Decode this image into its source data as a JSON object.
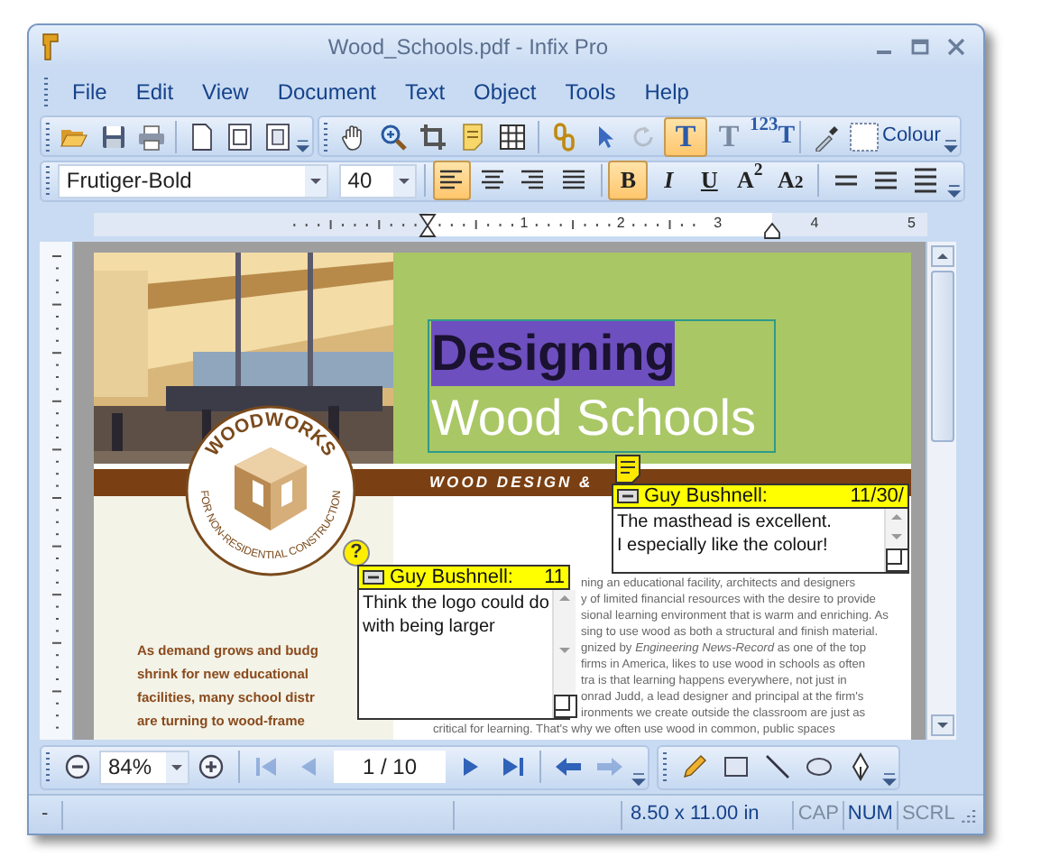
{
  "window": {
    "title": "Wood_Schools.pdf - Infix Pro"
  },
  "menu": [
    "File",
    "Edit",
    "View",
    "Document",
    "Text",
    "Object",
    "Tools",
    "Help"
  ],
  "standard_toolbar": {
    "groups": [
      [
        {
          "kind": "open",
          "selected": false,
          "disabled": false
        },
        {
          "kind": "save",
          "selected": false,
          "disabled": false
        },
        {
          "kind": "print",
          "selected": false,
          "disabled": false
        }
      ],
      [
        {
          "kind": "page",
          "selected": false,
          "disabled": false
        },
        {
          "kind": "page_frame",
          "selected": false,
          "disabled": false
        },
        {
          "kind": "page_corner",
          "selected": false,
          "disabled": false
        }
      ]
    ]
  },
  "tools_toolbar": {
    "groups": [
      [
        {
          "kind": "hand",
          "selected": false,
          "disabled": false
        },
        {
          "kind": "zoom",
          "selected": false,
          "disabled": false
        },
        {
          "kind": "crop",
          "selected": false,
          "disabled": false
        },
        {
          "kind": "note",
          "selected": false,
          "disabled": false
        },
        {
          "kind": "grid",
          "selected": false,
          "disabled": false
        }
      ],
      [
        {
          "kind": "link",
          "selected": false,
          "disabled": false
        },
        {
          "kind": "pointer",
          "selected": false,
          "disabled": false
        },
        {
          "kind": "rotate",
          "selected": false,
          "disabled": true
        },
        {
          "kind": "text_tool",
          "label": "T",
          "selected": true,
          "disabled": false
        },
        {
          "kind": "text_flow",
          "label": "T",
          "selected": false,
          "disabled": false
        },
        {
          "kind": "text_numbers",
          "label": "$^{123}$T",
          "selected": false,
          "disabled": false
        }
      ],
      [
        {
          "kind": "eyedropper",
          "selected": false,
          "disabled": false
        },
        {
          "kind": "colour",
          "label": "Colour",
          "selected": false,
          "disabled": false
        }
      ]
    ]
  },
  "format_toolbar": {
    "font": "Frutiger-Bold",
    "size": "40",
    "groups": [
      [
        {
          "kind": "align_left",
          "selected": true
        },
        {
          "kind": "align_center",
          "selected": false
        },
        {
          "kind": "align_right",
          "selected": false
        },
        {
          "kind": "justify",
          "selected": false
        }
      ],
      [
        {
          "kind": "style",
          "label": "B",
          "selected": true
        },
        {
          "kind": "style",
          "label": "I",
          "selected": false
        },
        {
          "kind": "style",
          "label": "U",
          "selected": false
        },
        {
          "kind": "style",
          "label": "A$^{2}$",
          "selected": false
        },
        {
          "kind": "style",
          "label": "A$_{2}$",
          "selected": false
        }
      ],
      [
        {
          "kind": "spacing_single",
          "selected": false
        },
        {
          "kind": "spacing_medium",
          "selected": false
        },
        {
          "kind": "spacing_double",
          "selected": false
        }
      ]
    ]
  },
  "ruler": [
    "1",
    "2",
    "3",
    "4",
    "5"
  ],
  "document": {
    "headline": [
      {
        "text": "Designing",
        "selected": true
      },
      {
        "text": "Wood Schools",
        "selected": false
      }
    ],
    "band": "WOOD DESIGN &",
    "logo": {
      "top": "WOODWORKS",
      "bottom": "FOR NON-RESIDENTIAL CONSTRUCTION"
    },
    "intro_lines": [
      "As demand grows and budg",
      "shrink for new educational",
      "facilities, many school distr",
      "are turning to wood-frame"
    ],
    "body_lines": [
      {
        "text": "ning an educational facility, architects and designers",
        "kind": "partial"
      },
      {
        "text": "y of limited financial resources with the desire to provide",
        "kind": "partial"
      },
      {
        "text": "sional learning environment that is warm and enriching. As",
        "kind": "partial"
      },
      {
        "text": "sing to use wood as both a structural and finish material.",
        "kind": "partial"
      },
      {
        "text": "gnized by *Engineering News-Record* as one of the top",
        "kind": "partial"
      },
      {
        "text": "firms in America, likes to use wood in schools as often",
        "kind": "partial"
      },
      {
        "text": "tra is that learning happens everywhere, not just in",
        "kind": "partial"
      },
      {
        "text": "onrad Judd, a lead designer and principal at the firm's",
        "kind": "partial"
      },
      {
        "text": "ironments we create outside the classroom are just as",
        "kind": "partial"
      },
      {
        "text": "critical for learning. That's why we often use wood in common, public spaces",
        "kind": "full"
      }
    ],
    "notes": [
      {
        "marker": {
          "kind": "comment"
        },
        "author": "Guy Bushnell:",
        "date": "11/30/",
        "lines": [
          "The masthead is excellent.",
          "I especially like the colour!"
        ]
      },
      {
        "marker": {
          "kind": "question",
          "label": "?"
        },
        "author": "Guy Bushnell:",
        "date": "11",
        "lines": [
          "Think the logo could do",
          "with being larger"
        ]
      }
    ]
  },
  "navigation_toolbar": {
    "zoom": "84%",
    "page": "1 / 10",
    "groups": [
      [
        {
          "kind": "zoom_out",
          "disabled": false
        }
      ],
      [
        {
          "kind": "zoom_in",
          "disabled": false
        }
      ],
      [
        {
          "kind": "first",
          "disabled": true
        },
        {
          "kind": "prev",
          "disabled": true
        }
      ],
      [
        {
          "kind": "next",
          "disabled": false
        },
        {
          "kind": "last",
          "disabled": false
        }
      ],
      [
        {
          "kind": "back",
          "disabled": false
        },
        {
          "kind": "forward",
          "disabled": true
        }
      ]
    ]
  },
  "drawing_toolbar": [
    {
      "kind": "pencil"
    },
    {
      "kind": "rectangle"
    },
    {
      "kind": "line"
    },
    {
      "kind": "ellipse"
    },
    {
      "kind": "pen"
    }
  ],
  "status_bar": {
    "left": "-",
    "page_size": "8.50 x 11.00 in",
    "indicators": [
      {
        "text": "CAP",
        "on": false
      },
      {
        "text": "NUM",
        "on": true
      },
      {
        "text": "SCRL",
        "on": false
      }
    ]
  }
}
